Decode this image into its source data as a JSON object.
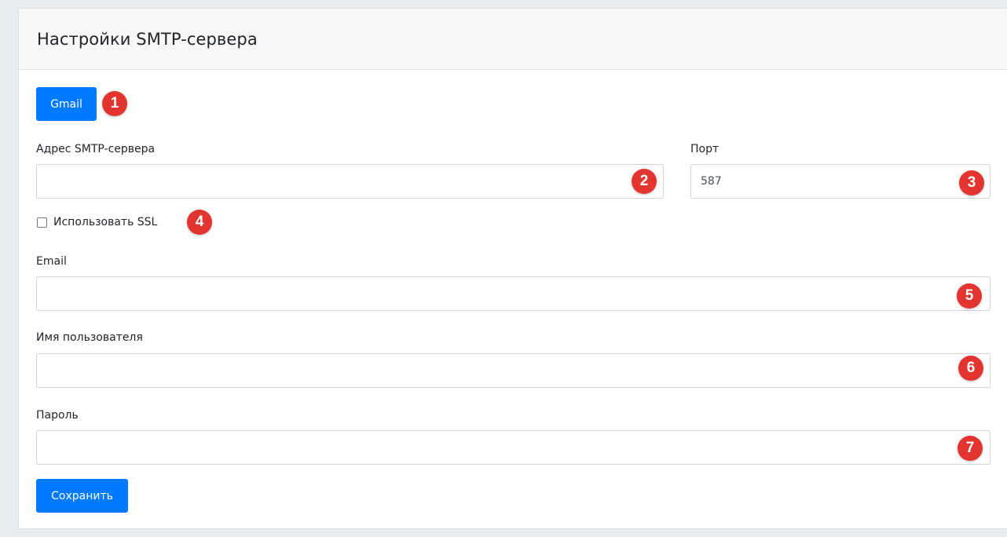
{
  "header": {
    "title": "Настройки SMTP-сервера"
  },
  "gmail_button": {
    "label": "Gmail"
  },
  "smtp_server": {
    "label": "Адрес SMTP-сервера",
    "value": ""
  },
  "port": {
    "label": "Порт",
    "value": "587"
  },
  "ssl": {
    "label": "Использовать SSL",
    "checked": false
  },
  "email": {
    "label": "Email",
    "value": ""
  },
  "username": {
    "label": "Имя пользователя",
    "value": ""
  },
  "password": {
    "label": "Пароль",
    "value": ""
  },
  "save_button": {
    "label": "Сохранить"
  },
  "annotations": [
    "1",
    "2",
    "3",
    "4",
    "5",
    "6",
    "7"
  ],
  "colors": {
    "primary": "#007bff",
    "annotation": "#e3342f",
    "background": "#e9ecef"
  }
}
